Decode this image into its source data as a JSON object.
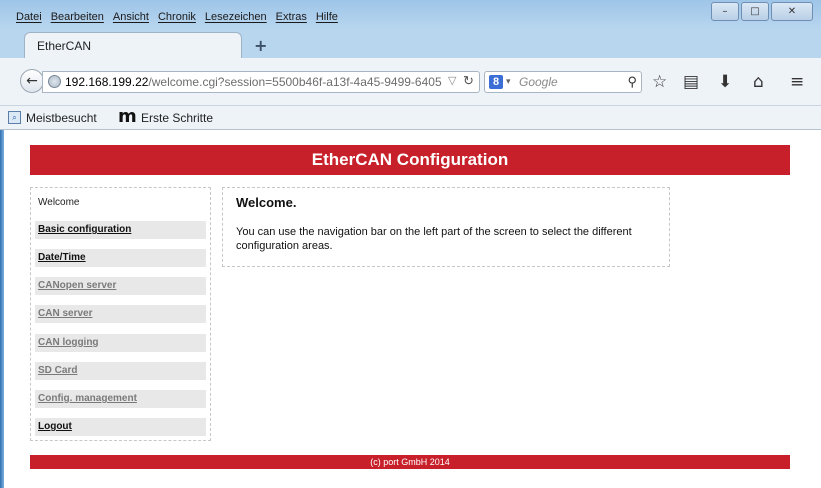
{
  "browser": {
    "menu": [
      "Datei",
      "Bearbeiten",
      "Ansicht",
      "Chronik",
      "Lesezeichen",
      "Extras",
      "Hilfe"
    ],
    "tab_title": "EtherCAN",
    "new_tab": "+",
    "url_host": "192.168.199.22",
    "url_path": "/welcome.cgi?session=5500b46f-a13f-4a45-9499-6405",
    "search_engine": "8",
    "search_placeholder": "Google",
    "bookmarks": [
      "Meistbesucht",
      "Erste Schritte"
    ],
    "window_buttons": [
      "–",
      "□",
      "✕"
    ]
  },
  "page": {
    "header_title": "EtherCAN Configuration",
    "sidebar": [
      {
        "label": "Welcome",
        "state": "current"
      },
      {
        "label": "Basic configuration",
        "state": "active"
      },
      {
        "label": "Date/Time",
        "state": "active"
      },
      {
        "label": "CANopen server",
        "state": "disabled"
      },
      {
        "label": "CAN server",
        "state": "disabled"
      },
      {
        "label": "CAN logging",
        "state": "disabled"
      },
      {
        "label": "SD Card",
        "state": "disabled"
      },
      {
        "label": "Config. management",
        "state": "disabled"
      },
      {
        "label": "Logout",
        "state": "active"
      }
    ],
    "content_title": "Welcome.",
    "content_text": "You can use the navigation bar on the left part of the screen to select the different configuration areas.",
    "footer": "(c) port GmbH 2014"
  },
  "colors": {
    "brand_red": "#c8202b"
  }
}
